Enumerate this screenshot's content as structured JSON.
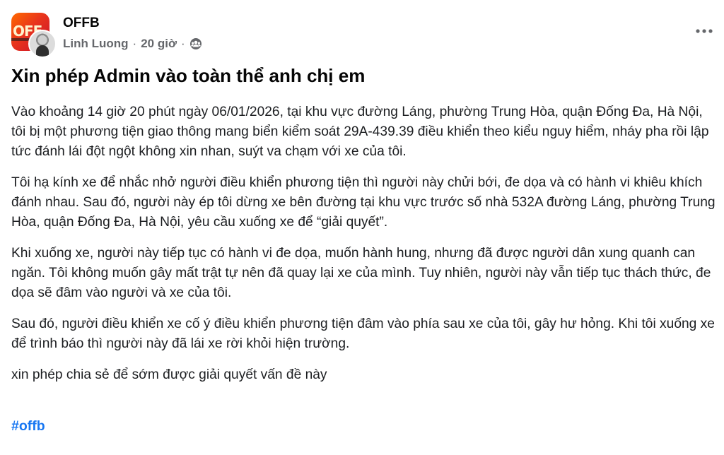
{
  "post": {
    "group_name": "OFFB",
    "group_avatar_text": "OFF",
    "author": "Linh Luong",
    "separator": "·",
    "time": "20 giờ",
    "audience_icon": "public-group-icon",
    "more_icon": "more-options-icon",
    "title": "Xin phép Admin vào toàn thể anh chị em",
    "paragraphs": [
      "Vào khoảng 14 giờ 20 phút ngày 06/01/2026, tại khu vực đường Láng, phường Trung Hòa, quận Đống Đa, Hà Nội, tôi bị một phương tiện giao thông mang biển kiểm soát 29A-439.39 điều khiển theo kiểu nguy hiểm, nháy pha rồi lập tức đánh lái đột ngột không xin nhan, suýt va chạm với xe của tôi.",
      "Tôi hạ kính xe để nhắc nhở người điều khiển phương tiện thì người này chửi bới, đe dọa và có hành vi khiêu khích đánh nhau. Sau đó, người này ép tôi dừng xe bên đường tại khu vực trước số nhà 532A đường Láng, phường Trung Hòa, quận Đống Đa, Hà Nội, yêu cầu xuống xe để “giải quyết”.",
      "Khi xuống xe, người này tiếp tục có hành vi đe dọa, muốn hành hung, nhưng đã được người dân xung quanh can ngăn. Tôi không muốn gây mất trật tự nên đã quay lại xe của mình. Tuy nhiên, người này vẫn tiếp tục thách thức, đe dọa sẽ đâm vào người và xe của tôi.",
      "Sau đó, người điều khiển xe cố ý điều khiển phương tiện đâm vào phía sau xe của tôi, gây hư hỏng. Khi tôi xuống xe để trình báo thì người này đã lái xe rời khỏi hiện trường.",
      "xin phép chia sẻ để sớm được giải quyết vấn đề này"
    ],
    "hashtag": "#offb"
  },
  "colors": {
    "text_primary": "#050505",
    "text_secondary": "#65676b",
    "link": "#1877f2",
    "group_avatar_gradient": [
      "#ff6a00",
      "#c8102e"
    ]
  }
}
